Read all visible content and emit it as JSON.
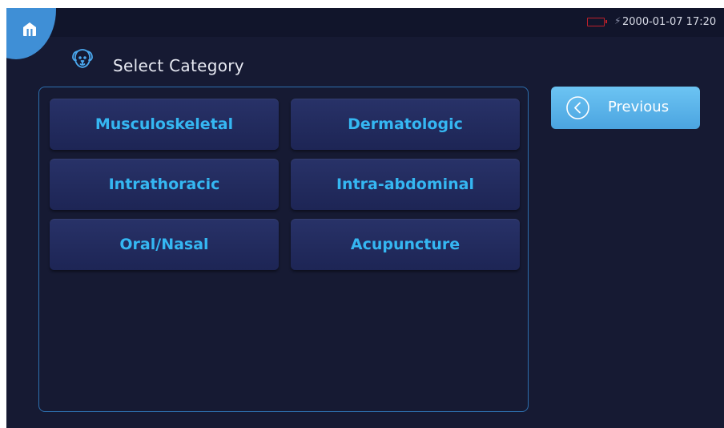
{
  "status": {
    "datetime": "2000-01-07 17:20",
    "charging_glyph": "⚡",
    "battery_color": "#c0202a"
  },
  "header": {
    "home_icon": "home-icon",
    "title_icon": "dog-face-icon",
    "title": "Select  Category"
  },
  "categories": [
    {
      "label": "Musculoskeletal"
    },
    {
      "label": "Dermatologic"
    },
    {
      "label": "Intrathoracic"
    },
    {
      "label": "Intra-abdominal"
    },
    {
      "label": "Oral/Nasal"
    },
    {
      "label": "Acupuncture"
    }
  ],
  "previous": {
    "label": "Previous",
    "icon": "chevron-left-circle-icon"
  },
  "colors": {
    "background": "#161a33",
    "topbar": "#11152b",
    "accent": "#3f8fd6",
    "category_text": "#35b7f2",
    "panel_border": "#2d6fae"
  }
}
